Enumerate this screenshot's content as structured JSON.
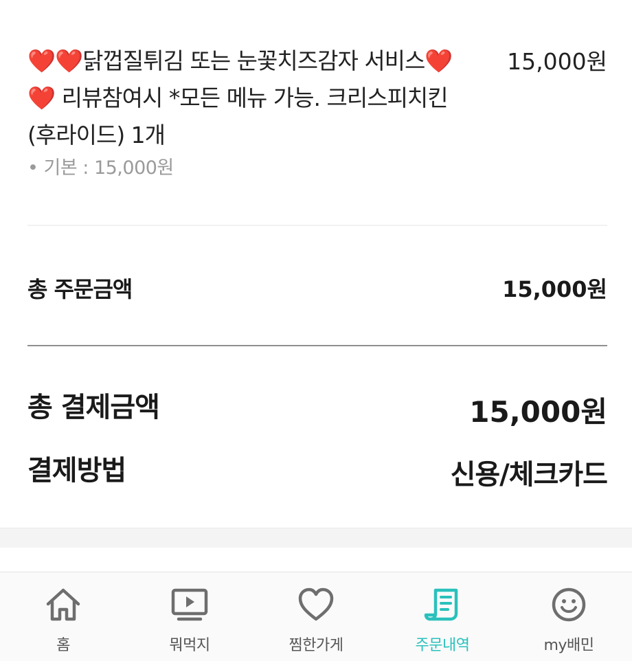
{
  "order_item": {
    "name": "❤️❤️닭껍질튀김 또는 눈꽃치즈감자 서비스❤️❤️ 리뷰참여시 *모든 메뉴 가능. 크리스피치킨(후라이드) 1개",
    "price": "15,000원",
    "option": "• 기본 : 15,000원"
  },
  "order_total": {
    "label": "총 주문금액",
    "value": "15,000원"
  },
  "payment_total": {
    "label": "총 결제금액",
    "value": "15,000원"
  },
  "payment_method": {
    "label": "결제방법",
    "value": "신용/체크카드"
  },
  "tabbar": {
    "tabs": [
      {
        "label": "홈",
        "icon": "home-icon",
        "active": false
      },
      {
        "label": "뭐먹지",
        "icon": "play-screen-icon",
        "active": false
      },
      {
        "label": "찜한가게",
        "icon": "heart-icon",
        "active": false
      },
      {
        "label": "주문내역",
        "icon": "receipt-icon",
        "active": true
      },
      {
        "label": "my배민",
        "icon": "smiley-icon",
        "active": false
      }
    ],
    "active_color": "#2ac1bc",
    "icon_color": "#6e6e6e"
  }
}
